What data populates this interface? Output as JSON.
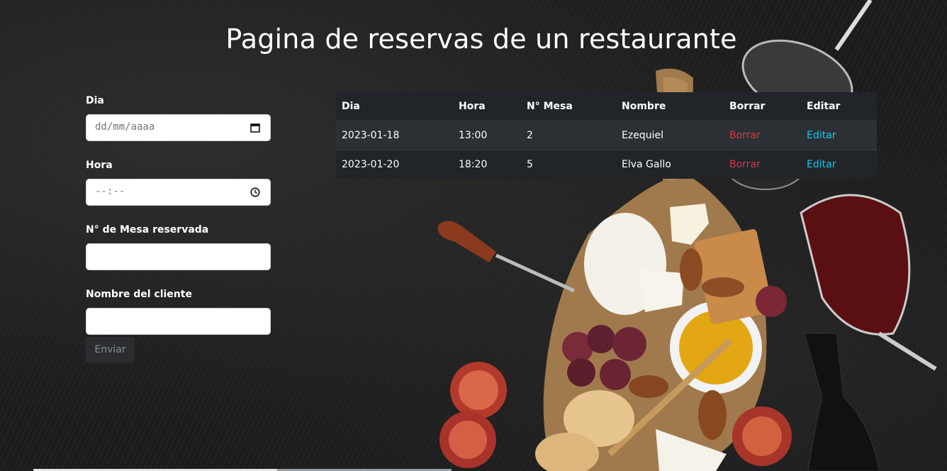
{
  "page": {
    "title": "Pagina de reservas de un restaurante"
  },
  "form": {
    "dia_label": "Dia",
    "dia_placeholder": "dd/mm/aaaa",
    "hora_label": "Hora",
    "hora_placeholder": "--:--",
    "mesa_label": "N° de Mesa reservada",
    "mesa_value": "",
    "nombre_label": "Nombre del cliente",
    "nombre_value": "",
    "submit_label": "Enviar"
  },
  "table": {
    "headers": [
      "Dia",
      "Hora",
      "N° Mesa",
      "Nombre",
      "Borrar",
      "Editar"
    ],
    "rows": [
      {
        "dia": "2023-01-18",
        "hora": "13:00",
        "mesa": "2",
        "nombre": "Ezequiel",
        "borrar": "Borrar",
        "editar": "Editar"
      },
      {
        "dia": "2023-01-20",
        "hora": "18:20",
        "mesa": "5",
        "nombre": "Elva Gallo",
        "borrar": "Borrar",
        "editar": "Editar"
      }
    ]
  },
  "colors": {
    "delete": "#dc3545",
    "edit": "#0dcaf0",
    "table_bg": "#212529"
  },
  "icons": {
    "date": "calendar-icon",
    "time": "clock-icon"
  }
}
